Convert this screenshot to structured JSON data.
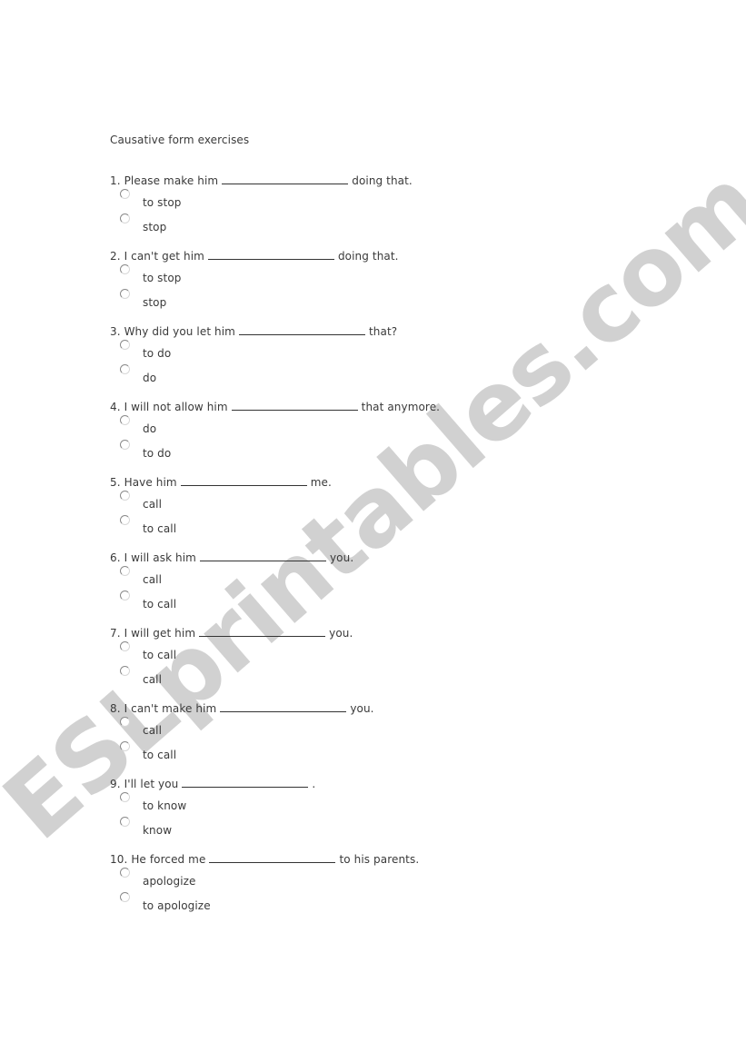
{
  "document": {
    "title": "Causative form exercises",
    "watermark": "ESLprintables.com"
  },
  "questions": [
    {
      "number": "1.",
      "before": "Please make him",
      "after": "doing that.",
      "options": [
        "to stop",
        "stop"
      ]
    },
    {
      "number": "2.",
      "before": "I can't get him",
      "after": "doing that.",
      "options": [
        "to stop",
        "stop"
      ]
    },
    {
      "number": "3.",
      "before": "Why did you let him",
      "after": "that?",
      "options": [
        "to do",
        "do"
      ]
    },
    {
      "number": "4.",
      "before": "I will not allow him",
      "after": "that anymore.",
      "options": [
        "do",
        "to do"
      ]
    },
    {
      "number": "5.",
      "before": "Have him",
      "after": "me.",
      "options": [
        "call",
        "to call"
      ]
    },
    {
      "number": "6.",
      "before": "I will ask him",
      "after": "you.",
      "options": [
        "call",
        "to call"
      ]
    },
    {
      "number": "7.",
      "before": "I will get him",
      "after": "you.",
      "options": [
        "to call",
        "call"
      ]
    },
    {
      "number": "8.",
      "before": "I can't make him",
      "after": "you.",
      "options": [
        "call",
        "to call"
      ]
    },
    {
      "number": "9.",
      "before": "I'll let you",
      "after": ".",
      "options": [
        "to know",
        "know"
      ]
    },
    {
      "number": "10.",
      "before": "He forced me",
      "after": "to his parents.",
      "options": [
        "apologize",
        "to apologize"
      ]
    }
  ]
}
